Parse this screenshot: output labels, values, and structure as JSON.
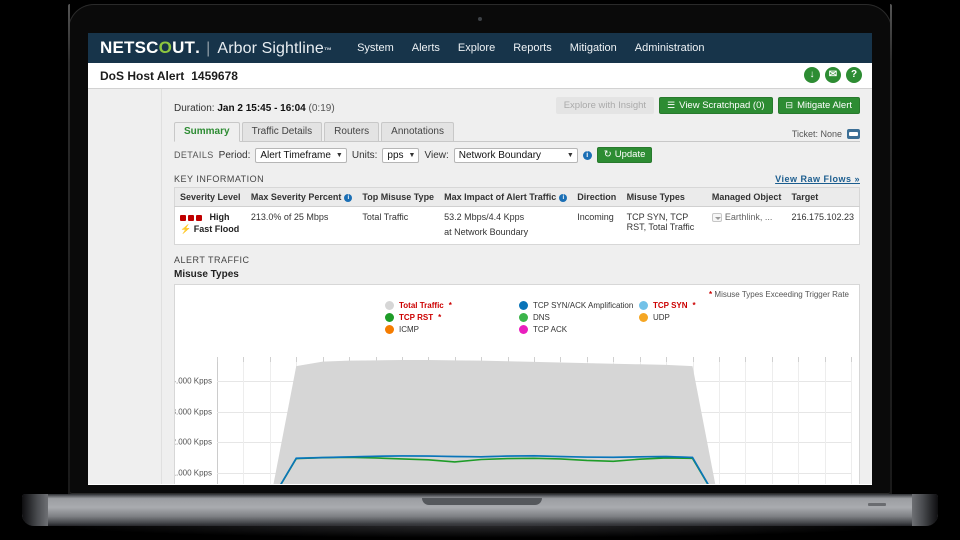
{
  "nav": {
    "brand_main": "NETSC",
    "brand_o": "O",
    "brand_ut": "UT",
    "brand_dot": ".",
    "separator": "|",
    "product": "Arbor Sightline",
    "tm": "™",
    "links": [
      {
        "label": "System"
      },
      {
        "label": "Alerts"
      },
      {
        "label": "Explore"
      },
      {
        "label": "Reports"
      },
      {
        "label": "Mitigation"
      },
      {
        "label": "Administration"
      }
    ]
  },
  "titlebar": {
    "title": "DoS Host Alert",
    "alert_id": "1459678",
    "icons": [
      {
        "name": "download-icon",
        "glyph": "↓"
      },
      {
        "name": "mail-icon",
        "glyph": "✉"
      },
      {
        "name": "help-icon",
        "glyph": "?"
      }
    ]
  },
  "duration": {
    "label": "Duration:",
    "value": "Jan 2 15:45 - 16:04",
    "elapsed": "(0:19)"
  },
  "actions": {
    "explore_insight": "Explore with Insight",
    "view_scratchpad": "View Scratchpad (0)",
    "mitigate_alert": "Mitigate Alert"
  },
  "tabs": [
    {
      "label": "Summary",
      "active": true
    },
    {
      "label": "Traffic Details",
      "active": false
    },
    {
      "label": "Routers",
      "active": false
    },
    {
      "label": "Annotations",
      "active": false
    }
  ],
  "ticket": {
    "label": "Ticket: None"
  },
  "details": {
    "section_label": "DETAILS",
    "period_label": "Period:",
    "period_value": "Alert Timeframe",
    "units_label": "Units:",
    "units_value": "pps",
    "view_label": "View:",
    "view_value": "Network Boundary",
    "info_glyph": "i",
    "update_label": "Update",
    "update_glyph": "↻"
  },
  "key_information": {
    "section_label": "KEY INFORMATION",
    "raw_flows_link": "View Raw Flows »",
    "columns": [
      {
        "label": "Severity Level",
        "info": false
      },
      {
        "label": "Max Severity Percent",
        "info": true
      },
      {
        "label": "Top Misuse Type",
        "info": false
      },
      {
        "label": "Max Impact of Alert Traffic",
        "info": true
      },
      {
        "label": "Direction",
        "info": false
      },
      {
        "label": "Misuse Types",
        "info": false
      },
      {
        "label": "Managed Object",
        "info": false
      },
      {
        "label": "Target",
        "info": false
      }
    ],
    "row": {
      "severity_label": "High",
      "severity_sub": "⚡ Fast Flood",
      "severity_dots": 3,
      "severity_color": "#c00000",
      "max_severity_percent": "213.0% of 25 Mbps",
      "top_misuse_type": "Total Traffic",
      "max_impact_line1": "53.2 Mbps/4.4 Kpps",
      "max_impact_line2": "at Network Boundary",
      "direction": "Incoming",
      "misuse_types": "TCP SYN, TCP RST, Total Traffic",
      "managed_object": "Earthlink, ...",
      "target": "216.175.102.23"
    }
  },
  "alert_traffic": {
    "section_label": "ALERT TRAFFIC",
    "subtitle": "Misuse Types",
    "trigger_note": "Misuse Types Exceeding Trigger Rate",
    "trigger_star": "*"
  },
  "chart_data": {
    "type": "area",
    "title": "Misuse Types",
    "xlabel": "",
    "ylabel": "",
    "ylim": [
      0,
      4800
    ],
    "yticks": [
      1000,
      2000,
      3000,
      4000
    ],
    "ytick_labels": [
      "1.000 Kpps",
      "2.000 Kpps",
      "3.000 Kpps",
      "4.000 Kpps"
    ],
    "unit": "Kpps",
    "grid": true,
    "legend_position": "top-center",
    "legend": [
      {
        "name": "Total Traffic",
        "color": "#d6d6d6",
        "exceeds_trigger": true
      },
      {
        "name": "TCP RST",
        "color": "#1e9c28",
        "exceeds_trigger": true
      },
      {
        "name": "ICMP",
        "color": "#f57c00",
        "exceeds_trigger": false
      },
      {
        "name": "TCP SYN/ACK Amplification",
        "color": "#0a74b8",
        "exceeds_trigger": false
      },
      {
        "name": "DNS",
        "color": "#3cb44b",
        "exceeds_trigger": false
      },
      {
        "name": "TCP ACK",
        "color": "#e91ebe",
        "exceeds_trigger": false
      },
      {
        "name": "TCP SYN",
        "color": "#73c2e8",
        "exceeds_trigger": true
      },
      {
        "name": "UDP",
        "color": "#f5a623",
        "exceeds_trigger": false
      }
    ],
    "x": [
      0,
      1,
      2,
      3,
      4,
      5,
      6,
      7,
      8,
      9,
      10,
      11,
      12,
      13,
      14,
      15,
      16,
      17,
      18,
      19,
      20,
      21,
      22,
      23,
      24
    ],
    "series": [
      {
        "name": "Total Traffic",
        "color": "#d6d6d6",
        "type": "area",
        "values": [
          0,
          0,
          0,
          4500,
          4650,
          4680,
          4690,
          4700,
          4700,
          4690,
          4680,
          4660,
          4640,
          4620,
          4600,
          4580,
          4560,
          4540,
          4500,
          0,
          0,
          0,
          0,
          0,
          0
        ]
      },
      {
        "name": "TCP SYN",
        "color": "#73c2e8",
        "type": "line",
        "values": [
          0,
          0,
          0,
          1480,
          1500,
          1520,
          1540,
          1550,
          1545,
          1530,
          1520,
          1545,
          1555,
          1530,
          1510,
          1505,
          1520,
          1530,
          1500,
          0,
          0,
          0,
          0,
          0,
          0
        ]
      },
      {
        "name": "TCP RST",
        "color": "#1e9c28",
        "type": "line",
        "values": [
          0,
          0,
          0,
          1460,
          1490,
          1500,
          1480,
          1450,
          1420,
          1350,
          1430,
          1460,
          1470,
          1450,
          1400,
          1370,
          1440,
          1480,
          1470,
          0,
          0,
          0,
          0,
          0,
          0
        ]
      },
      {
        "name": "TCP SYN/ACK Amplification",
        "color": "#0a74b8",
        "type": "line",
        "values": [
          0,
          0,
          0,
          1470,
          1495,
          1515,
          1535,
          1548,
          1542,
          1528,
          1518,
          1542,
          1552,
          1528,
          1508,
          1502,
          1518,
          1528,
          1498,
          0,
          0,
          0,
          0,
          0,
          0
        ]
      }
    ]
  }
}
